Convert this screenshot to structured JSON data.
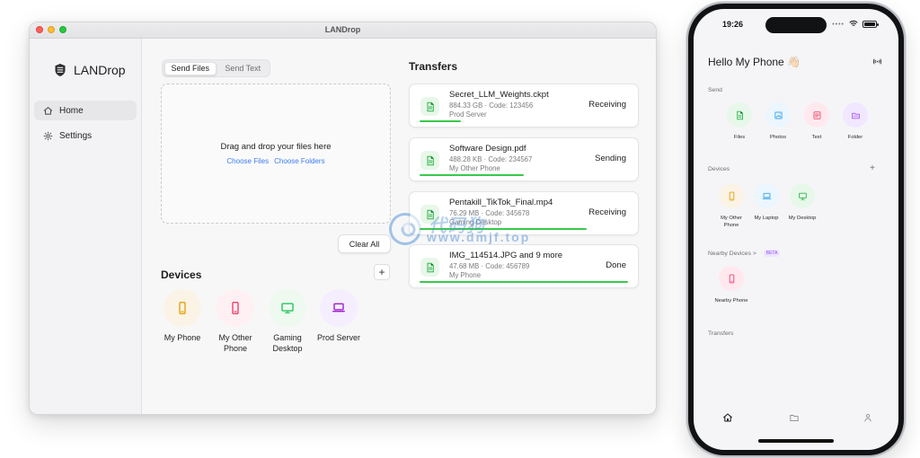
{
  "desktop": {
    "window_title": "LANDrop",
    "brand": "LANDrop",
    "sidebar": {
      "items": [
        {
          "label": "Home",
          "icon": "home-icon",
          "active": true
        },
        {
          "label": "Settings",
          "icon": "gear-icon",
          "active": false
        }
      ]
    },
    "tabs": [
      {
        "label": "Send Files",
        "active": true
      },
      {
        "label": "Send Text",
        "active": false
      }
    ],
    "dropzone": {
      "title": "Drag and drop your files here",
      "choose_files": "Choose Files",
      "choose_folders": "Choose Folders"
    },
    "clear_all": "Clear All",
    "devices_title": "Devices",
    "add_button": "+",
    "devices": [
      {
        "label": "My Phone",
        "icon": "phone-icon",
        "color": "#E7A20A",
        "tone": "tone-yellow"
      },
      {
        "label": "My Other Phone",
        "icon": "phone-icon",
        "color": "#F43F6D",
        "tone": "tone-pink"
      },
      {
        "label": "Gaming Desktop",
        "icon": "desktop-icon",
        "color": "#22C55E",
        "tone": "tone-green"
      },
      {
        "label": "Prod Server",
        "icon": "laptop-icon",
        "color": "#A21CCF",
        "tone": "tone-purple"
      }
    ],
    "transfers_title": "Transfers",
    "transfers": [
      {
        "name": "Secret_LLM_Weights.ckpt",
        "meta": "884.33 GB · Code: 123456",
        "from": "Prod Server",
        "status": "Receiving",
        "progress": 0.2
      },
      {
        "name": "Software Design.pdf",
        "meta": "488.28 KB · Code: 234567",
        "from": "My Other Phone",
        "status": "Sending",
        "progress": 0.5
      },
      {
        "name": "Pentakill_TikTok_Final.mp4",
        "meta": "76.29 MB · Code: 345678",
        "from": "Gaming Desktop",
        "status": "Receiving",
        "progress": 0.8
      },
      {
        "name": "IMG_114514.JPG and 9 more",
        "meta": "47.68 MB · Code: 456789",
        "from": "My Phone",
        "status": "Done",
        "progress": 1.0
      }
    ]
  },
  "phone": {
    "time": "19:26",
    "title": "Hello My Phone 👋🏻",
    "send_section": "Send",
    "send_items": [
      {
        "label": "Files",
        "icon": "file-icon",
        "color": "#2CB34A",
        "tone": "tone-green2"
      },
      {
        "label": "Photos",
        "icon": "image-icon",
        "color": "#38A6E9",
        "tone": "tone-blue"
      },
      {
        "label": "Text",
        "icon": "text-icon",
        "color": "#EF4B6B",
        "tone": "tone-rose"
      },
      {
        "label": "Folder",
        "icon": "folder-icon",
        "color": "#A855F7",
        "tone": "tone-violet"
      }
    ],
    "devices_section": "Devices",
    "add_device": "+",
    "devices": [
      {
        "label": "My Other Phone",
        "icon": "phone-icon",
        "color": "#E7A20A",
        "tone": "tone-yellow"
      },
      {
        "label": "My Laptop",
        "icon": "laptop-icon",
        "color": "#38A6E9",
        "tone": "tone-blue"
      },
      {
        "label": "My Desktop",
        "icon": "desktop-icon",
        "color": "#2CB34A",
        "tone": "tone-green2"
      }
    ],
    "nearby_section": "Nearby Devices",
    "nearby_chevron": ">",
    "beta": "BETA",
    "nearby_devices": [
      {
        "label": "Nearby Phone",
        "icon": "phone-icon",
        "color": "#F43F6D",
        "tone": "tone-rose"
      }
    ],
    "transfers_section": "Transfers"
  },
  "watermark": {
    "cn": "代码狗",
    "en": "www.dmjf.top"
  }
}
